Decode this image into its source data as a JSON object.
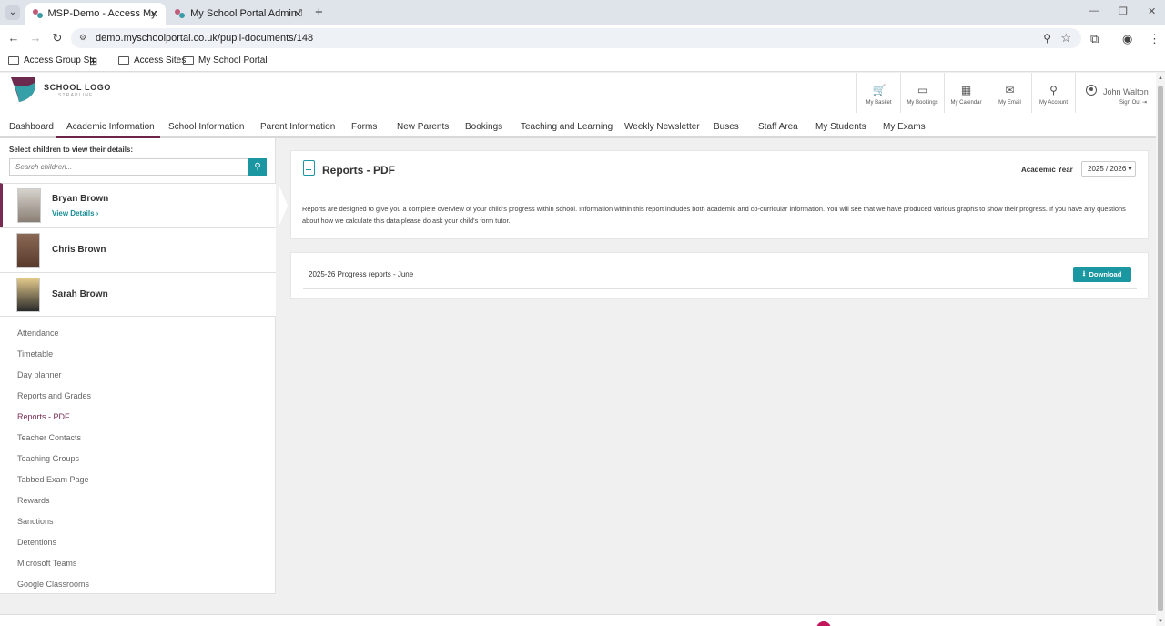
{
  "browser": {
    "tabs": [
      {
        "title": "MSP-Demo - Access My Schoo",
        "close": "✕"
      },
      {
        "title": "My School Portal Admin Tools",
        "close": "✕"
      }
    ],
    "new_tab": "+",
    "url": "demo.myschoolportal.co.uk/pupil-documents/148",
    "bookmarks": [
      "Access Group Std",
      "Access Sites",
      "My School Portal"
    ],
    "window_controls": [
      "—",
      "❐",
      "✕"
    ]
  },
  "header": {
    "logo_text": "SCHOOL LOGO",
    "logo_strapline": "STRAPLINE",
    "items": [
      {
        "label": "My Basket",
        "icon": "cart-icon",
        "glyph": "🛒"
      },
      {
        "label": "My Bookings",
        "icon": "ticket-icon",
        "glyph": "▭"
      },
      {
        "label": "My Calendar",
        "icon": "calendar-icon",
        "glyph": "▦"
      },
      {
        "label": "My Email",
        "icon": "mail-icon",
        "glyph": "✉"
      },
      {
        "label": "My Account",
        "icon": "person-icon",
        "glyph": "⚲"
      }
    ],
    "user_name": "John Walton",
    "sign_out": "Sign Out ⇥"
  },
  "nav": {
    "items": [
      "Dashboard",
      "Academic Information",
      "School Information",
      "Parent Information",
      "Forms",
      "New Parents",
      "Bookings",
      "Teaching and Learning",
      "Weekly Newsletter",
      "Buses",
      "Staff Area",
      "My Students",
      "My Exams"
    ],
    "active_index": 1
  },
  "sidebar": {
    "select_label": "Select children to view their details:",
    "search_placeholder": "Search children...",
    "children": [
      {
        "name": "Bryan Brown",
        "selected": true,
        "view_details": "View Details ›"
      },
      {
        "name": "Chris Brown",
        "selected": false
      },
      {
        "name": "Sarah Brown",
        "selected": false
      }
    ],
    "links": [
      "Attendance",
      "Timetable",
      "Day planner",
      "Reports and Grades",
      "Reports - PDF",
      "Teacher Contacts",
      "Teaching Groups",
      "Tabbed Exam Page",
      "Rewards",
      "Sanctions",
      "Detentions",
      "Microsoft Teams",
      "Google Classrooms"
    ],
    "active_link": "Reports - PDF"
  },
  "main": {
    "title": "Reports - PDF",
    "academic_year_label": "Academic Year",
    "academic_year_value": "2025 / 2026 ▾",
    "intro": "Reports are designed to give you a complete overview of your child's progress within school. Information within this report includes both academic and co-curricular information. You will see that we have produced various graphs to show their progress. If you have any questions about how we calculate this data please do ask your child's form tutor.",
    "reports": [
      {
        "name": "2025-26 Progress reports - June",
        "action": "Download"
      }
    ]
  },
  "colors": {
    "accent_teal": "#1a97a0",
    "brand_plum": "#7a2a52"
  }
}
